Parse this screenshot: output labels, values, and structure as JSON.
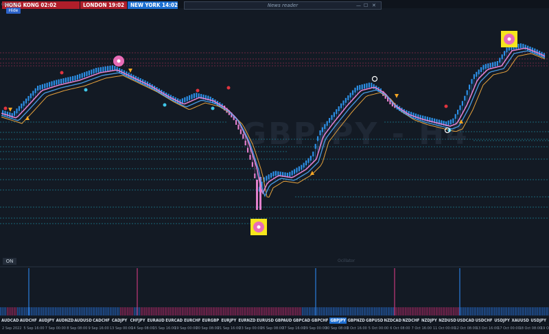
{
  "clocks": [
    {
      "city": "HONG KONG",
      "time": "02:02",
      "text": "HONG KONG  02:02"
    },
    {
      "city": "LONDON",
      "time": "19:02",
      "text": "LONDON   19:02"
    },
    {
      "city": "NEW YORK",
      "time": "14:02",
      "text": "NEW YORK  14:02"
    }
  ],
  "hide_label": "Hide",
  "news_reader": {
    "title": "News reader",
    "minimize": "—",
    "maximize": "☐",
    "close": "✕"
  },
  "chart": {
    "symbol_label": "GBPJPY,H4",
    "watermark": "GBPJPY - H4",
    "colors": {
      "bull": "#2b8fe6",
      "bear": "#e27fcc",
      "fast_ma": "#e27fcc",
      "slow_ma": "#e8a33d",
      "up_signal": "#f5a623",
      "down_signal": "#e0343e",
      "highlight_box": "#f6e61d"
    }
  },
  "on_label": "ON",
  "subwindow_label": "Ocillator",
  "pairs": [
    "AUDCAD",
    "AUDCHF",
    "AUDJPY",
    "AUDNZD",
    "AUDUSD",
    "CADCHF",
    "CADJPY",
    "CHFJPY",
    "EURAUD",
    "EURCAD",
    "EURCHF",
    "EURGBP",
    "EURJPY",
    "EURNZD",
    "EURUSD",
    "GBPAUD",
    "GBPCAD",
    "GBPCHF",
    "GBPJPY",
    "GBPNZD",
    "GBPUSD",
    "NZDCAD",
    "NZDCHF",
    "NZDJPY",
    "NZDUSD",
    "USDCAD",
    "USDCHF",
    "USDJPY",
    "XAUUSD",
    "USDJPY"
  ],
  "active_pair": "GBPJPY",
  "dates": [
    "2 Sep 2022",
    "5 Sep 16:00",
    "7 Sep 00:00",
    "8 Sep 08:00",
    "9 Sep 16:00",
    "13 Sep 00:00",
    "14 Sep 08:00",
    "15 Sep 16:00",
    "19 Sep 00:00",
    "20 Sep 08:00",
    "21 Sep 16:00",
    "23 Sep 00:00",
    "26 Sep 08:00",
    "27 Sep 16:00",
    "29 Sep 00:00",
    "30 Sep 08:00",
    "3 Oct 16:00",
    "5 Oct 00:00",
    "6 Oct 08:00",
    "7 Oct 16:00",
    "11 Oct 00:00",
    "12 Oct 08:00",
    "13 Oct 16:00",
    "17 Oct 00:00",
    "18 Oct 08:00",
    "19 Oct"
  ]
}
